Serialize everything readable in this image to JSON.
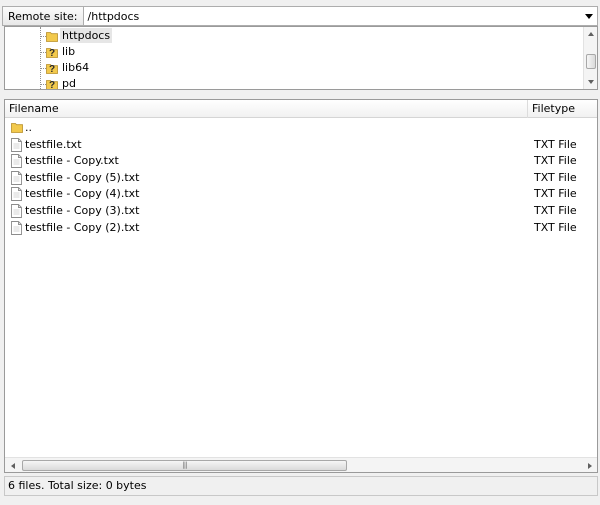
{
  "remote_bar": {
    "label": "Remote site:",
    "path": "/httpdocs"
  },
  "tree": {
    "items": [
      {
        "label": "httpdocs",
        "icon": "folder-icon",
        "selected": true
      },
      {
        "label": "lib",
        "icon": "question-folder-icon",
        "selected": false
      },
      {
        "label": "lib64",
        "icon": "question-folder-icon",
        "selected": false
      },
      {
        "label": "pd",
        "icon": "question-folder-icon",
        "selected": false
      }
    ]
  },
  "file_list": {
    "columns": {
      "filename": "Filename",
      "filetype": "Filetype"
    },
    "rows": [
      {
        "name": "..",
        "type": "",
        "icon": "folder-icon"
      },
      {
        "name": "testfile.txt",
        "type": "TXT File",
        "icon": "text-file-icon"
      },
      {
        "name": "testfile - Copy.txt",
        "type": "TXT File",
        "icon": "text-file-icon"
      },
      {
        "name": "testfile - Copy (5).txt",
        "type": "TXT File",
        "icon": "text-file-icon"
      },
      {
        "name": "testfile - Copy (4).txt",
        "type": "TXT File",
        "icon": "text-file-icon"
      },
      {
        "name": "testfile - Copy (3).txt",
        "type": "TXT File",
        "icon": "text-file-icon"
      },
      {
        "name": "testfile - Copy (2).txt",
        "type": "TXT File",
        "icon": "text-file-icon"
      }
    ]
  },
  "status": {
    "text": "6 files. Total size: 0 bytes"
  },
  "colors": {
    "folder": "#f2c94c",
    "question": "#2a2a2a",
    "selection": "#e6e6e6",
    "border": "#9a9a9a"
  }
}
